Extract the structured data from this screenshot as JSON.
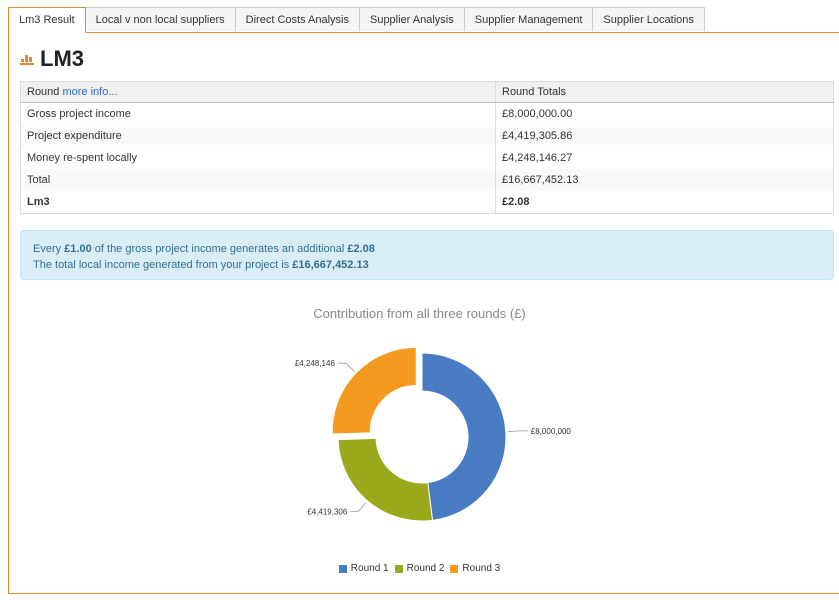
{
  "tabs": [
    {
      "label": "Lm3 Result",
      "active": true
    },
    {
      "label": "Local v non local suppliers",
      "active": false
    },
    {
      "label": "Direct Costs Analysis",
      "active": false
    },
    {
      "label": "Supplier Analysis",
      "active": false
    },
    {
      "label": "Supplier Management",
      "active": false
    },
    {
      "label": "Supplier Locations",
      "active": false
    }
  ],
  "page": {
    "title": "LM3",
    "title_icon": "bar-chart-icon",
    "icon_color": "#e58a2c"
  },
  "table": {
    "header_round": "Round",
    "header_link": "more info...",
    "header_totals": "Round Totals",
    "rows": [
      {
        "label": "Gross project income",
        "value": "£8,000,000.00"
      },
      {
        "label": "Project expenditure",
        "value": "£4,419,305.86"
      },
      {
        "label": "Money re-spent locally",
        "value": "£4,248,146.27"
      },
      {
        "label": "Total",
        "value": "£16,667,452.13"
      },
      {
        "label": "Lm3",
        "value": "£2.08"
      }
    ]
  },
  "alert": {
    "line1_pre": "Every",
    "line1_amount": "£1.00",
    "line1_mid": "of the gross project income generates an additional",
    "line1_value": "£2.08",
    "line2_pre": "The total local income generated from your project is",
    "line2_value": "£16,667,452.13"
  },
  "chart_data": {
    "type": "pie",
    "title": "Contribution from all three rounds (£)",
    "categories": [
      "Round 1",
      "Round 2",
      "Round 3"
    ],
    "values": [
      8000000,
      4419306,
      4248146
    ],
    "labels": [
      "£8,000,000",
      "£4,419,306",
      "£4,248,146"
    ],
    "colors": [
      "#4a7cc4",
      "#9aaa1c",
      "#f59a20"
    ],
    "legend": "bottom",
    "donut": true
  }
}
